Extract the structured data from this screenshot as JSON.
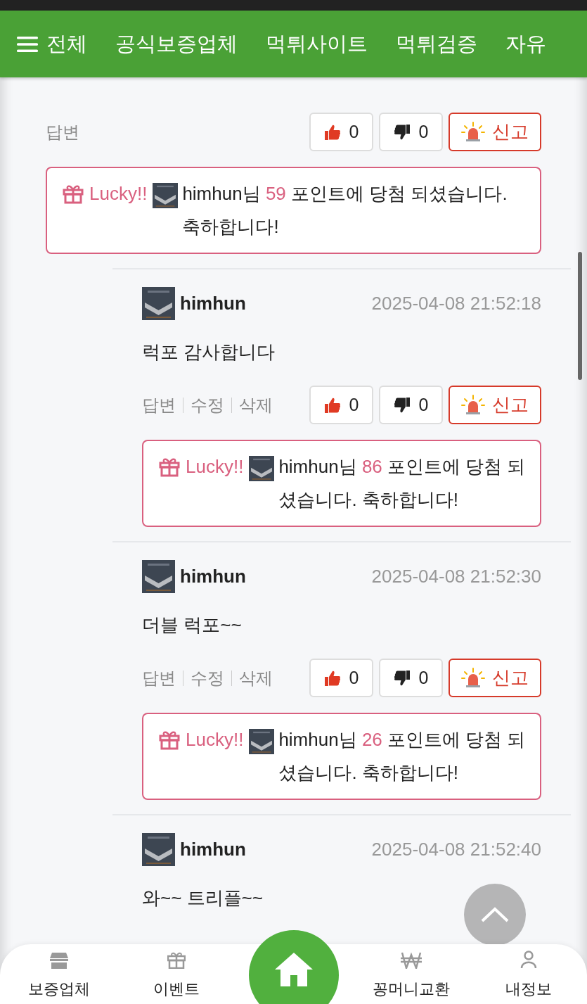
{
  "nav": {
    "menu_label": "전체",
    "items": [
      "공식보증업체",
      "먹튀사이트",
      "먹튀검증",
      "자유"
    ]
  },
  "comments": [
    {
      "kind": "reply",
      "actions": [
        "답변"
      ],
      "likes": "0",
      "dislikes": "0",
      "report": "신고",
      "lucky": {
        "label": "Lucky!!",
        "user": "himhun님",
        "points": "59",
        "message": "포인트에 당첨 되셨습니다. 축하합니다!"
      }
    },
    {
      "kind": "comment",
      "author": "himhun",
      "date": "2025-04-08 21:52:18",
      "body": "럭포 감사합니다",
      "actions": [
        "답변",
        "수정",
        "삭제"
      ],
      "likes": "0",
      "dislikes": "0",
      "report": "신고",
      "lucky": {
        "label": "Lucky!!",
        "user": "himhun님",
        "points": "86",
        "message": "포인트에 당첨 되셨습니다. 축하합니다!"
      }
    },
    {
      "kind": "comment",
      "author": "himhun",
      "date": "2025-04-08 21:52:30",
      "body": "더블 럭포~~",
      "actions": [
        "답변",
        "수정",
        "삭제"
      ],
      "likes": "0",
      "dislikes": "0",
      "report": "신고",
      "lucky": {
        "label": "Lucky!!",
        "user": "himhun님",
        "points": "26",
        "message": "포인트에 당첨 되셨습니다. 축하합니다!"
      }
    },
    {
      "kind": "comment",
      "author": "himhun",
      "date": "2025-04-08 21:52:40",
      "body": "와~~ 트리플~~"
    }
  ],
  "bottom_nav": [
    {
      "kind": "store",
      "label": "보증업체"
    },
    {
      "kind": "gift",
      "label": "이벤트"
    },
    {
      "kind": "home"
    },
    {
      "kind": "won",
      "label": "꽁머니교환"
    },
    {
      "kind": "person",
      "label": "내정보"
    }
  ]
}
